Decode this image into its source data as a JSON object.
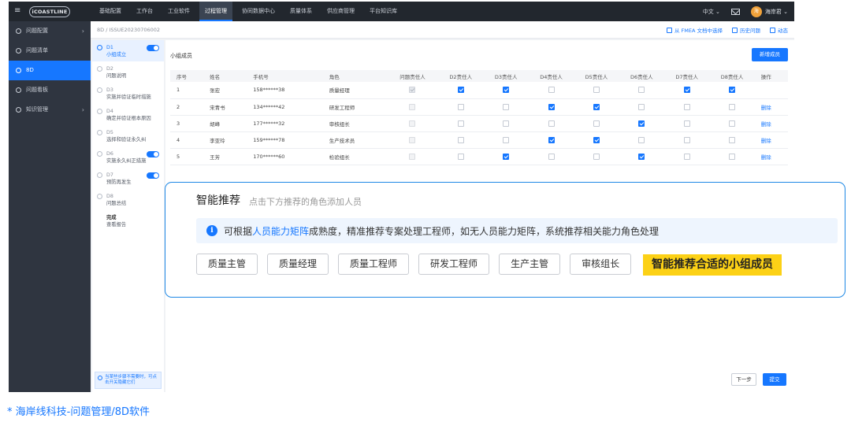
{
  "topnav": {
    "logo": "iCOASTLINE",
    "items": [
      {
        "label": "基础配置"
      },
      {
        "label": "工作台"
      },
      {
        "label": "工业软件"
      },
      {
        "label": "过程管理"
      },
      {
        "label": "协同数据中心"
      },
      {
        "label": "质量体系"
      },
      {
        "label": "供应商管理"
      },
      {
        "label": "平台知识库"
      }
    ],
    "active_item": "过程管理",
    "language": "中文 ⌄",
    "user": "海岸君 ⌄",
    "avatar_text": "海"
  },
  "sidebar": {
    "items": [
      {
        "label": "问题配置",
        "chevron": "›"
      },
      {
        "label": "问题清单",
        "chevron": ""
      },
      {
        "label": "8D",
        "chevron": ""
      },
      {
        "label": "问题看板",
        "chevron": ""
      },
      {
        "label": "知识管理",
        "chevron": "›"
      }
    ],
    "active_item": "8D"
  },
  "breadcrumb": {
    "root": "8D",
    "separator": "/",
    "current": "ISSUE20230706002"
  },
  "crumb_actions": [
    {
      "label": "从 FMEA 文档中选择",
      "icon": "copy-icon"
    },
    {
      "label": "历史问题",
      "icon": "list-icon"
    },
    {
      "label": "动态",
      "icon": "file-icon"
    }
  ],
  "steps": {
    "items": [
      {
        "code": "D1",
        "desc": "小组成立",
        "toggle": true,
        "active": true
      },
      {
        "code": "D2",
        "desc": "问题说明",
        "toggle": false,
        "active": false
      },
      {
        "code": "D3",
        "desc": "实施并验证临时措施",
        "toggle": false,
        "active": false
      },
      {
        "code": "D4",
        "desc": "确定并验证根本原因",
        "toggle": false,
        "active": false
      },
      {
        "code": "D5",
        "desc": "选择和验证永久纠",
        "toggle": false,
        "active": false
      },
      {
        "code": "D6",
        "desc": "实施永久纠正措施",
        "toggle": true,
        "active": false
      },
      {
        "code": "D7",
        "desc": "预防再发生",
        "toggle": true,
        "active": false
      },
      {
        "code": "D8",
        "desc": "问题总结",
        "toggle": false,
        "active": false
      }
    ],
    "finish": {
      "title": "完成",
      "desc": "查看报告"
    },
    "tip": "当某些步骤不需要时，可点击开关隐藏它们"
  },
  "members": {
    "title": "小组成员",
    "add_button": "新增成员",
    "columns": [
      "序号",
      "姓名",
      "手机号",
      "角色",
      "问题责任人",
      "D2责任人",
      "D3责任人",
      "D4责任人",
      "D5责任人",
      "D6责任人",
      "D7责任人",
      "D8责任人",
      "操作"
    ],
    "rows": [
      {
        "no": "1",
        "name": "张宏",
        "phone": "158******38",
        "role": "质量经理",
        "owner": true,
        "checks": [
          true,
          true,
          false,
          false,
          false,
          true,
          true
        ],
        "action": ""
      },
      {
        "no": "2",
        "name": "宋青书",
        "phone": "134******42",
        "role": "研发工程师",
        "owner": false,
        "checks": [
          false,
          false,
          true,
          true,
          false,
          false,
          false
        ],
        "action": "删除"
      },
      {
        "no": "3",
        "name": "胡峰",
        "phone": "177******32",
        "role": "审核组长",
        "owner": false,
        "checks": [
          false,
          false,
          false,
          false,
          true,
          false,
          false
        ],
        "action": "删除"
      },
      {
        "no": "4",
        "name": "李亚玲",
        "phone": "159******78",
        "role": "生产技术员",
        "owner": false,
        "checks": [
          false,
          false,
          true,
          true,
          false,
          false,
          false
        ],
        "action": "删除"
      },
      {
        "no": "5",
        "name": "王芳",
        "phone": "170******60",
        "role": "检验组长",
        "owner": false,
        "checks": [
          false,
          true,
          false,
          false,
          true,
          false,
          false
        ],
        "action": "删除"
      }
    ]
  },
  "footer": {
    "next_button": "下一步",
    "submit_button": "提交"
  },
  "overlay": {
    "title": "智能推荐",
    "subtitle": "点击下方推荐的角色添加人员",
    "info_prefix": "可根据",
    "info_link": "人员能力矩阵",
    "info_suffix": "成熟度，精准推荐专案处理工程师，如无人员能力矩阵，系统推荐相关能力角色处理",
    "tags": [
      "质量主管",
      "质量经理",
      "质量工程师",
      "研发工程师",
      "生产主管",
      "审核组长"
    ],
    "highlight": "智能推荐合适的小组成员"
  },
  "caption": "* 海岸线科技-问题管理/8D软件",
  "colors": {
    "accent": "#1677ff",
    "nav_bg": "#22272e",
    "sidebar_bg": "#2f3540",
    "highlight": "#fcd116"
  }
}
